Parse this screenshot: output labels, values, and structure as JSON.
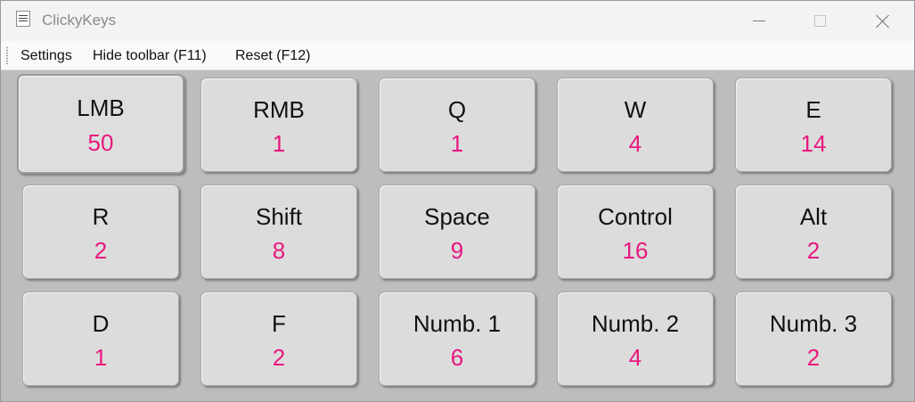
{
  "window": {
    "title": "ClickyKeys",
    "icon": "clickykeys-app-icon",
    "controls": [
      "minimize",
      "maximize",
      "close"
    ]
  },
  "menu": {
    "settings": "Settings",
    "hide_toolbar": "Hide toolbar (F11)",
    "reset": "Reset (F12)"
  },
  "colors": {
    "count_color": "#e8177e",
    "key_background": "#dcdcdc",
    "panel_background": "#bdbdbd"
  },
  "keys": [
    {
      "label": "LMB",
      "count": "50"
    },
    {
      "label": "RMB",
      "count": "1"
    },
    {
      "label": "Q",
      "count": "1"
    },
    {
      "label": "W",
      "count": "4"
    },
    {
      "label": "E",
      "count": "14"
    },
    {
      "label": "R",
      "count": "2"
    },
    {
      "label": "Shift",
      "count": "8"
    },
    {
      "label": "Space",
      "count": "9"
    },
    {
      "label": "Control",
      "count": "16"
    },
    {
      "label": "Alt",
      "count": "2"
    },
    {
      "label": "D",
      "count": "1"
    },
    {
      "label": "F",
      "count": "2"
    },
    {
      "label": "Numb. 1",
      "count": "6"
    },
    {
      "label": "Numb. 2",
      "count": "4"
    },
    {
      "label": "Numb. 3",
      "count": "2"
    }
  ]
}
